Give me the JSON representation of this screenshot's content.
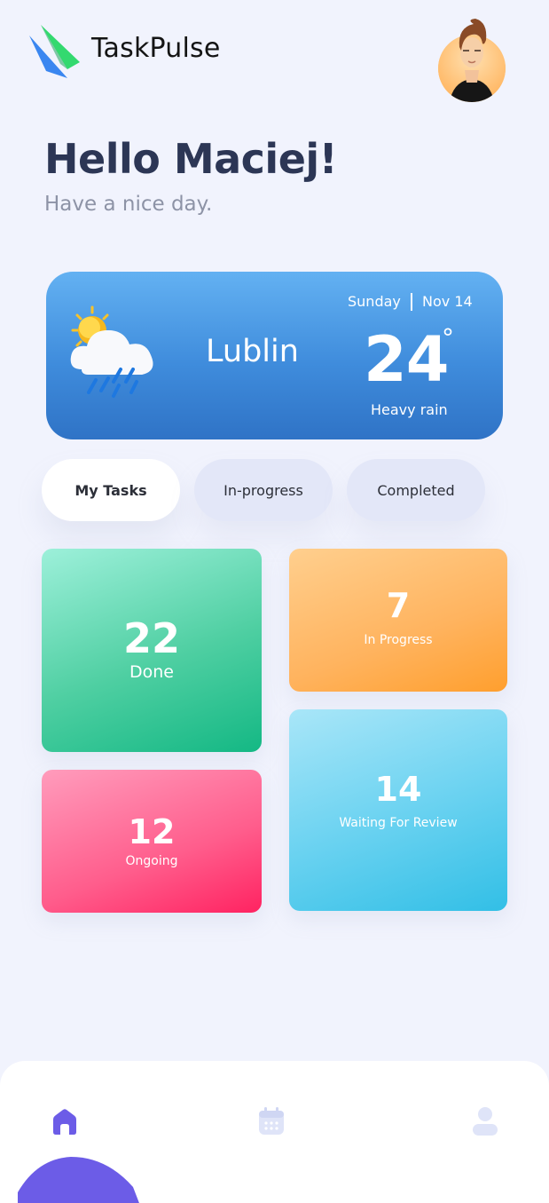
{
  "header": {
    "app_name": "TaskPulse",
    "avatar": "user-avatar-illustration"
  },
  "greeting": {
    "title": "Hello Maciej!",
    "subtitle": "Have a nice day."
  },
  "weather": {
    "icon": "sun-cloud-rain-icon",
    "city": "Lublin",
    "day": "Sunday",
    "date": "Nov 14",
    "temperature": "24",
    "degree_symbol": "°",
    "condition": "Heavy rain"
  },
  "tabs": [
    {
      "label": "My Tasks",
      "active": true
    },
    {
      "label": "In-progress",
      "active": false
    },
    {
      "label": "Completed",
      "active": false
    }
  ],
  "stats": {
    "done": {
      "count": "22",
      "label": "Done"
    },
    "in_progress": {
      "count": "7",
      "label": "In Progress"
    },
    "ongoing": {
      "count": "12",
      "label": "Ongoing"
    },
    "waiting_review": {
      "count": "14",
      "label": "Waiting For Review"
    }
  },
  "nav": {
    "items": [
      {
        "icon": "home-icon",
        "active": true
      },
      {
        "icon": "calendar-icon",
        "active": false
      },
      {
        "icon": "user-icon",
        "active": false
      }
    ]
  },
  "colors": {
    "accent": "#6c5ce7",
    "background": "#f1f3fd",
    "heading": "#2c3655",
    "weather_card": "#3f8cdc",
    "done": "#14b884",
    "in_progress": "#ff9f2e",
    "ongoing": "#ff2361",
    "waiting_review": "#32bfe6"
  }
}
